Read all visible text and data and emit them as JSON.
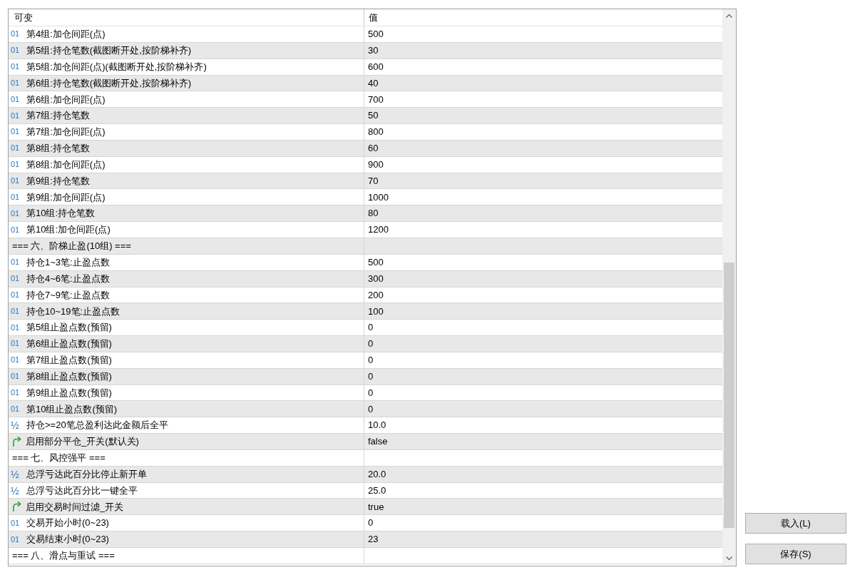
{
  "table": {
    "columns": [
      "可变",
      "值"
    ],
    "rows": [
      {
        "kind": "int",
        "icon": "01",
        "name": "第4组:加仓间距(点)",
        "value": "500"
      },
      {
        "kind": "int",
        "icon": "01",
        "name": "第5组:持仓笔数(截图断开处,按阶梯补齐)",
        "value": "30"
      },
      {
        "kind": "int",
        "icon": "01",
        "name": "第5组:加仓间距(点)(截图断开处,按阶梯补齐)",
        "value": "600"
      },
      {
        "kind": "int",
        "icon": "01",
        "name": "第6组:持仓笔数(截图断开处,按阶梯补齐)",
        "value": "40"
      },
      {
        "kind": "int",
        "icon": "01",
        "name": "第6组:加仓间距(点)",
        "value": "700"
      },
      {
        "kind": "int",
        "icon": "01",
        "name": "第7组:持仓笔数",
        "value": "50"
      },
      {
        "kind": "int",
        "icon": "01",
        "name": "第7组:加仓间距(点)",
        "value": "800"
      },
      {
        "kind": "int",
        "icon": "01",
        "name": "第8组:持仓笔数",
        "value": "60"
      },
      {
        "kind": "int",
        "icon": "01",
        "name": "第8组:加仓间距(点)",
        "value": "900"
      },
      {
        "kind": "int",
        "icon": "01",
        "name": "第9组:持仓笔数",
        "value": "70"
      },
      {
        "kind": "int",
        "icon": "01",
        "name": "第9组:加仓间距(点)",
        "value": "1000"
      },
      {
        "kind": "int",
        "icon": "01",
        "name": "第10组:持仓笔数",
        "value": "80"
      },
      {
        "kind": "int",
        "icon": "01",
        "name": "第10组:加仓间距(点)",
        "value": "1200"
      },
      {
        "kind": "section",
        "name": "=== 六、阶梯止盈(10组) ==="
      },
      {
        "kind": "int",
        "icon": "01",
        "name": "持仓1~3笔:止盈点数",
        "value": "500"
      },
      {
        "kind": "int",
        "icon": "01",
        "name": "持仓4~6笔:止盈点数",
        "value": "300"
      },
      {
        "kind": "int",
        "icon": "01",
        "name": "持仓7~9笔:止盈点数",
        "value": "200"
      },
      {
        "kind": "int",
        "icon": "01",
        "name": "持仓10~19笔:止盈点数",
        "value": "100"
      },
      {
        "kind": "int",
        "icon": "01",
        "name": "第5组止盈点数(预留)",
        "value": "0"
      },
      {
        "kind": "int",
        "icon": "01",
        "name": "第6组止盈点数(预留)",
        "value": "0"
      },
      {
        "kind": "int",
        "icon": "01",
        "name": "第7组止盈点数(预留)",
        "value": "0"
      },
      {
        "kind": "int",
        "icon": "01",
        "name": "第8组止盈点数(预留)",
        "value": "0"
      },
      {
        "kind": "int",
        "icon": "01",
        "name": "第9组止盈点数(预留)",
        "value": "0"
      },
      {
        "kind": "int",
        "icon": "01",
        "name": "第10组止盈点数(预留)",
        "value": "0"
      },
      {
        "kind": "double",
        "icon": "½",
        "name": "持仓>=20笔总盈利达此金额后全平",
        "value": "10.0"
      },
      {
        "kind": "bool",
        "name": "启用部分平仓_开关(默认关)",
        "value": "false"
      },
      {
        "kind": "section",
        "name": "=== 七、风控强平 ==="
      },
      {
        "kind": "double",
        "icon": "½",
        "name": "总浮亏达此百分比停止新开单",
        "value": "20.0"
      },
      {
        "kind": "double",
        "icon": "½",
        "name": "总浮亏达此百分比一键全平",
        "value": "25.0"
      },
      {
        "kind": "bool",
        "name": "启用交易时间过滤_开关",
        "value": "true"
      },
      {
        "kind": "int",
        "icon": "01",
        "name": "交易开始小时(0~23)",
        "value": "0"
      },
      {
        "kind": "int",
        "icon": "01",
        "name": "交易结束小时(0~23)",
        "value": "23"
      },
      {
        "kind": "section",
        "name": "=== 八、滑点与重试 ==="
      }
    ]
  },
  "buttons": [
    {
      "label": "载入(L)"
    },
    {
      "label": "保存(S)"
    }
  ]
}
